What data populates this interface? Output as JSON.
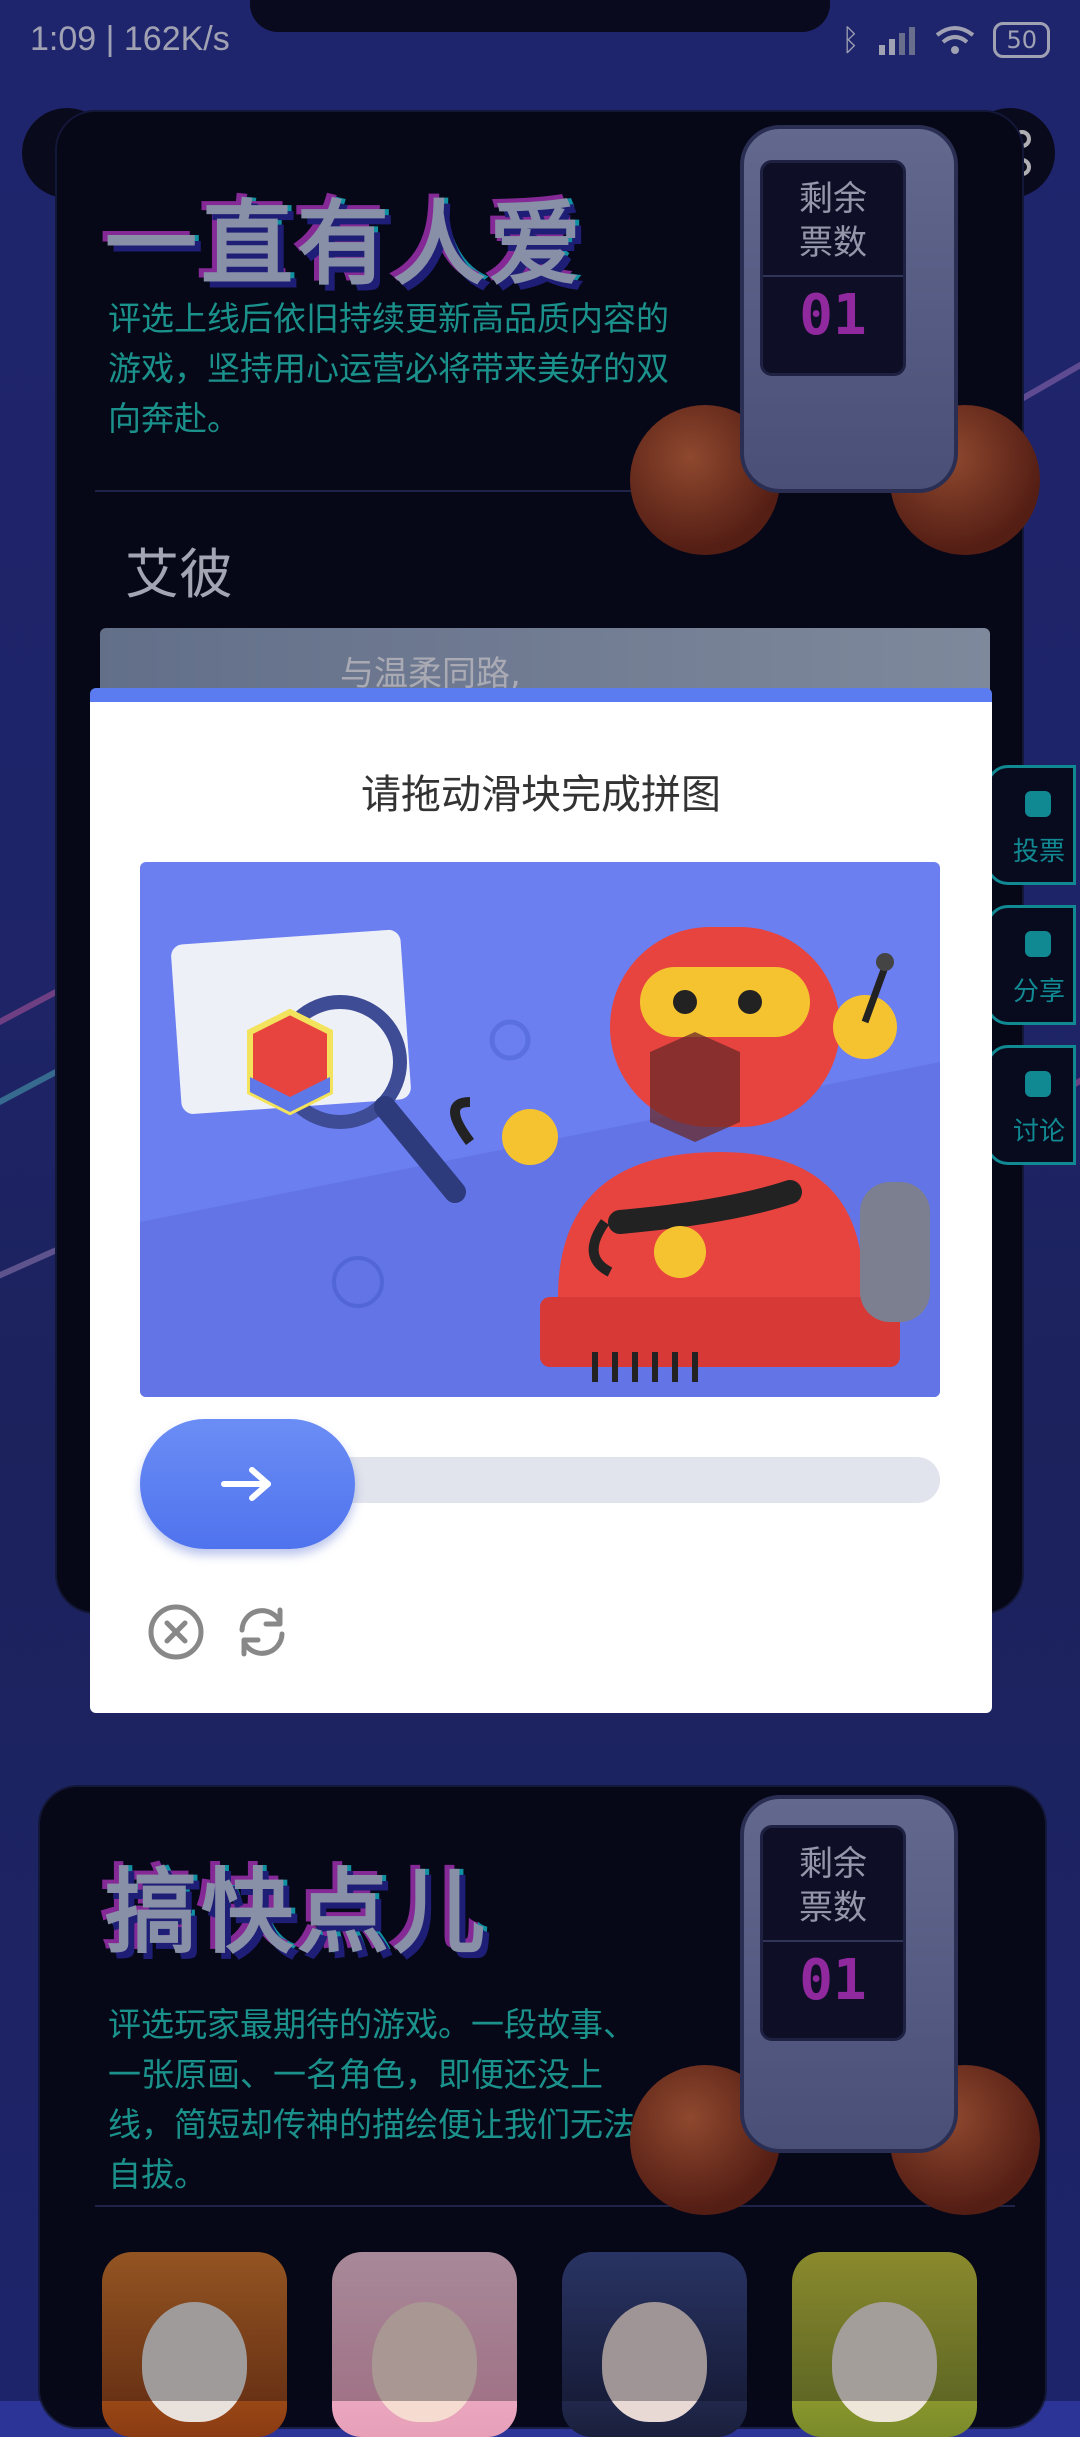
{
  "status_bar": {
    "time": "1:09 | 162K/s",
    "battery": "50",
    "icons": [
      "bluetooth-icon",
      "signal-icon",
      "wifi-icon",
      "battery-icon"
    ]
  },
  "nav": {
    "back_icon": "back-arrow-icon",
    "share_icon": "share-icon"
  },
  "section1": {
    "title": "一直有人爱",
    "description": "评选上线后依旧持续更新高品质内容的游戏，坚持用心运营必将带来美好的双向奔赴。",
    "game_name": "艾彼",
    "banner_text": "与温柔同路,",
    "robot": {
      "label_line1": "剩余",
      "label_line2": "票数",
      "count": "01"
    }
  },
  "side_buttons": [
    {
      "label": "投票"
    },
    {
      "label": "分享"
    },
    {
      "label": "讨论"
    }
  ],
  "captcha": {
    "title": "请拖动滑块完成拼图",
    "slider_position": 0,
    "close_icon": "close-circle-icon",
    "refresh_icon": "refresh-icon"
  },
  "section2": {
    "title": "搞快点儿",
    "description": "评选玩家最期待的游戏。一段故事、一张原画、一名角色，即便还没上线，简短却传神的描绘便让我们无法自拔。",
    "robot": {
      "label_line1": "剩余",
      "label_line2": "票数",
      "count": "01"
    }
  },
  "colors": {
    "background": "#2c3498",
    "accent_cyan": "#26d3c5",
    "accent_magenta": "#d23adf",
    "modal_accent": "#5b7cf0"
  }
}
